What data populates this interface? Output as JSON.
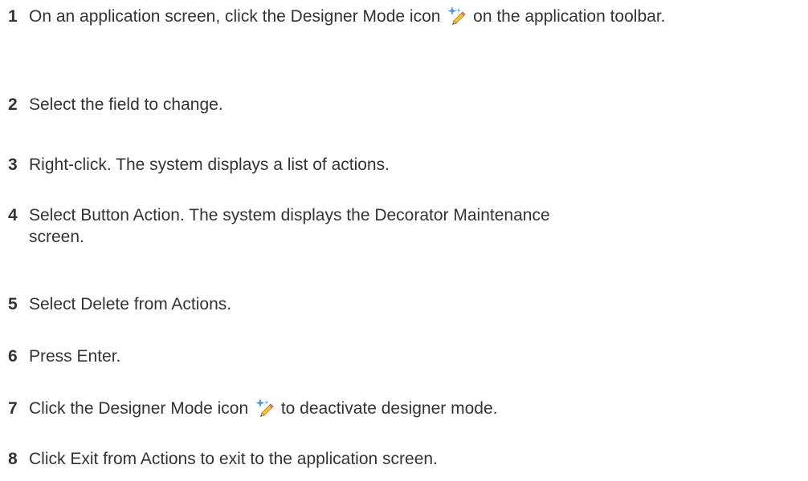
{
  "steps": [
    {
      "number": "1",
      "text_before_icon": "On an application screen, click the Designer Mode icon",
      "icon": "designer-mode-icon",
      "text_after_icon": "on the application toolbar."
    },
    {
      "number": "2",
      "text": "Select the field to change."
    },
    {
      "number": "3",
      "text": "Right-click. The system displays a list of actions."
    },
    {
      "number": "4",
      "text": "Select Button Action. The system displays the Decorator Maintenance screen."
    },
    {
      "number": "5",
      "text": "Select Delete from Actions."
    },
    {
      "number": "6",
      "text": "Press Enter."
    },
    {
      "number": "7",
      "text_before_icon": "Click the Designer Mode icon",
      "icon": "designer-mode-icon",
      "text_after_icon": "to deactivate designer mode."
    },
    {
      "number": "8",
      "text": "Click Exit from Actions to exit to the application screen."
    }
  ],
  "colors": {
    "text": "#333333",
    "background": "#ffffff",
    "icon_blue": "#4a9be0",
    "icon_pencil": "#f2c23a"
  }
}
